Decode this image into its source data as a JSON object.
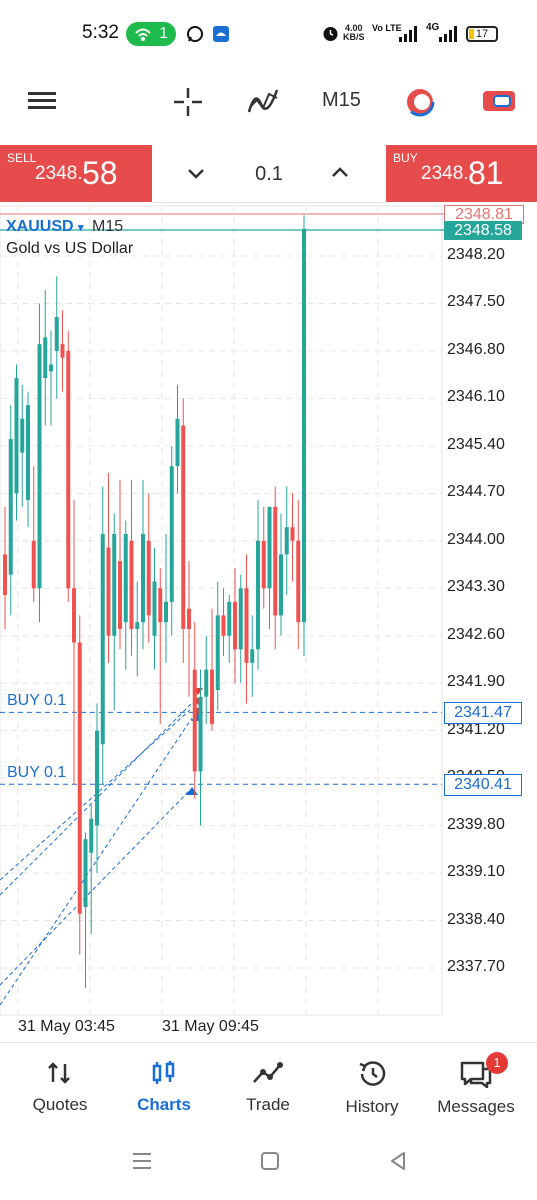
{
  "status_bar": {
    "time": "5:32",
    "hotspot_count": "1",
    "net_speed": "4.00",
    "net_unit": "KB/S",
    "volte": "Vo LTE",
    "signal": "4G",
    "battery": "17"
  },
  "toolbar": {
    "timeframe": "M15",
    "icons": [
      "menu-icon",
      "crosshair-icon",
      "indicators-icon",
      "timeframe-selector",
      "one-click-trading-icon",
      "chart-type-icon"
    ]
  },
  "trade_bar": {
    "sell_label": "SELL",
    "sell_price_small": "2348.",
    "sell_price_big": "58",
    "lot": "0.1",
    "buy_label": "BUY",
    "buy_price_small": "2348.",
    "buy_price_big": "81"
  },
  "chart": {
    "symbol": "XAUUSD",
    "dropdown": "▾",
    "timeframe": "M15",
    "description": "Gold vs US Dollar",
    "buy_label_1": "BUY 0.1",
    "buy_label_2": "BUY 0.1",
    "price_bid": "2348.58",
    "price_ask": "2348.81",
    "order_1_price": "2341.47",
    "order_2_price": "2340.41",
    "y_ticks": [
      "2348.20",
      "2347.50",
      "2346.80",
      "2346.10",
      "2345.40",
      "2344.70",
      "2344.00",
      "2343.30",
      "2342.60",
      "2341.90",
      "2341.20",
      "2340.50",
      "2339.80",
      "2339.10",
      "2338.40",
      "2337.70"
    ],
    "x_ticks": [
      "31 May 03:45",
      "31 May 09:45"
    ]
  },
  "chart_data": {
    "type": "candlestick",
    "title": "XAUUSD M15",
    "ylim": [
      2337.2,
      2348.9
    ],
    "bull_color": "#26a69a",
    "bear_color": "#ef5350",
    "candles": [
      {
        "o": 2343.8,
        "h": 2344.5,
        "l": 2342.7,
        "c": 2343.2
      },
      {
        "o": 2343.5,
        "h": 2346.0,
        "l": 2342.9,
        "c": 2345.5
      },
      {
        "o": 2344.7,
        "h": 2346.6,
        "l": 2344.3,
        "c": 2346.4
      },
      {
        "o": 2345.3,
        "h": 2346.3,
        "l": 2344.5,
        "c": 2345.8
      },
      {
        "o": 2344.6,
        "h": 2346.2,
        "l": 2344.2,
        "c": 2346.0
      },
      {
        "o": 2344.0,
        "h": 2345.1,
        "l": 2343.1,
        "c": 2343.3
      },
      {
        "o": 2343.3,
        "h": 2347.5,
        "l": 2342.8,
        "c": 2346.9
      },
      {
        "o": 2346.4,
        "h": 2347.7,
        "l": 2345.7,
        "c": 2347.0
      },
      {
        "o": 2346.5,
        "h": 2347.1,
        "l": 2345.7,
        "c": 2346.6
      },
      {
        "o": 2346.8,
        "h": 2347.9,
        "l": 2346.1,
        "c": 2347.3
      },
      {
        "o": 2346.9,
        "h": 2347.4,
        "l": 2346.2,
        "c": 2346.7
      },
      {
        "o": 2346.8,
        "h": 2347.1,
        "l": 2343.1,
        "c": 2343.3
      },
      {
        "o": 2343.3,
        "h": 2344.6,
        "l": 2340.4,
        "c": 2342.5
      },
      {
        "o": 2342.5,
        "h": 2342.9,
        "l": 2337.9,
        "c": 2338.5
      },
      {
        "o": 2338.6,
        "h": 2339.7,
        "l": 2337.4,
        "c": 2339.6
      },
      {
        "o": 2339.4,
        "h": 2340.1,
        "l": 2338.2,
        "c": 2339.9
      },
      {
        "o": 2339.8,
        "h": 2341.6,
        "l": 2339.1,
        "c": 2341.2
      },
      {
        "o": 2341.0,
        "h": 2344.8,
        "l": 2340.4,
        "c": 2344.1
      },
      {
        "o": 2343.9,
        "h": 2345.0,
        "l": 2342.2,
        "c": 2342.6
      },
      {
        "o": 2342.6,
        "h": 2344.4,
        "l": 2341.5,
        "c": 2344.1
      },
      {
        "o": 2343.7,
        "h": 2344.9,
        "l": 2342.4,
        "c": 2342.7
      },
      {
        "o": 2342.8,
        "h": 2344.3,
        "l": 2342.1,
        "c": 2344.1
      },
      {
        "o": 2344.0,
        "h": 2344.9,
        "l": 2342.3,
        "c": 2342.7
      },
      {
        "o": 2342.7,
        "h": 2343.4,
        "l": 2342.0,
        "c": 2342.8
      },
      {
        "o": 2342.8,
        "h": 2344.9,
        "l": 2342.4,
        "c": 2344.1
      },
      {
        "o": 2344.0,
        "h": 2344.7,
        "l": 2342.5,
        "c": 2342.9
      },
      {
        "o": 2342.6,
        "h": 2343.9,
        "l": 2342.1,
        "c": 2343.4
      },
      {
        "o": 2343.3,
        "h": 2343.6,
        "l": 2341.3,
        "c": 2342.8
      },
      {
        "o": 2342.8,
        "h": 2344.1,
        "l": 2342.2,
        "c": 2343.1
      },
      {
        "o": 2343.1,
        "h": 2345.4,
        "l": 2342.6,
        "c": 2345.1
      },
      {
        "o": 2345.1,
        "h": 2346.3,
        "l": 2344.7,
        "c": 2345.8
      },
      {
        "o": 2345.7,
        "h": 2346.1,
        "l": 2342.2,
        "c": 2342.7
      },
      {
        "o": 2343.0,
        "h": 2343.7,
        "l": 2341.7,
        "c": 2342.7
      },
      {
        "o": 2342.1,
        "h": 2342.8,
        "l": 2340.2,
        "c": 2340.6
      },
      {
        "o": 2340.6,
        "h": 2342.1,
        "l": 2339.8,
        "c": 2341.7
      },
      {
        "o": 2341.7,
        "h": 2342.6,
        "l": 2341.3,
        "c": 2342.1
      },
      {
        "o": 2342.1,
        "h": 2343.0,
        "l": 2341.2,
        "c": 2341.3
      },
      {
        "o": 2341.8,
        "h": 2343.4,
        "l": 2341.5,
        "c": 2342.9
      },
      {
        "o": 2342.9,
        "h": 2343.3,
        "l": 2342.3,
        "c": 2342.6
      },
      {
        "o": 2342.6,
        "h": 2343.2,
        "l": 2342.2,
        "c": 2343.1
      },
      {
        "o": 2343.1,
        "h": 2343.6,
        "l": 2341.9,
        "c": 2342.4
      },
      {
        "o": 2342.4,
        "h": 2343.5,
        "l": 2341.9,
        "c": 2343.3
      },
      {
        "o": 2343.3,
        "h": 2343.8,
        "l": 2341.6,
        "c": 2342.2
      },
      {
        "o": 2342.2,
        "h": 2342.9,
        "l": 2341.7,
        "c": 2342.4
      },
      {
        "o": 2342.4,
        "h": 2344.6,
        "l": 2342.1,
        "c": 2344.0
      },
      {
        "o": 2344.0,
        "h": 2344.5,
        "l": 2343.0,
        "c": 2343.3
      },
      {
        "o": 2343.3,
        "h": 2344.5,
        "l": 2342.7,
        "c": 2344.5
      },
      {
        "o": 2344.5,
        "h": 2344.8,
        "l": 2342.4,
        "c": 2342.9
      },
      {
        "o": 2342.9,
        "h": 2344.4,
        "l": 2342.6,
        "c": 2343.8
      },
      {
        "o": 2343.8,
        "h": 2344.8,
        "l": 2343.2,
        "c": 2344.2
      },
      {
        "o": 2344.2,
        "h": 2344.7,
        "l": 2343.4,
        "c": 2344.0
      },
      {
        "o": 2344.0,
        "h": 2344.6,
        "l": 2342.4,
        "c": 2342.8
      },
      {
        "o": 2342.8,
        "h": 2348.8,
        "l": 2342.3,
        "c": 2348.6
      }
    ]
  },
  "bottom_nav": [
    {
      "label": "Quotes",
      "icon": "quotes-icon"
    },
    {
      "label": "Charts",
      "icon": "charts-icon",
      "active": true
    },
    {
      "label": "Trade",
      "icon": "trade-icon"
    },
    {
      "label": "History",
      "icon": "history-icon"
    },
    {
      "label": "Messages",
      "icon": "messages-icon",
      "badge": "1"
    }
  ],
  "colors": {
    "sell": "#e74c4c",
    "accent": "#1a6fd4",
    "bull": "#26a69a",
    "bear": "#ef5350"
  }
}
